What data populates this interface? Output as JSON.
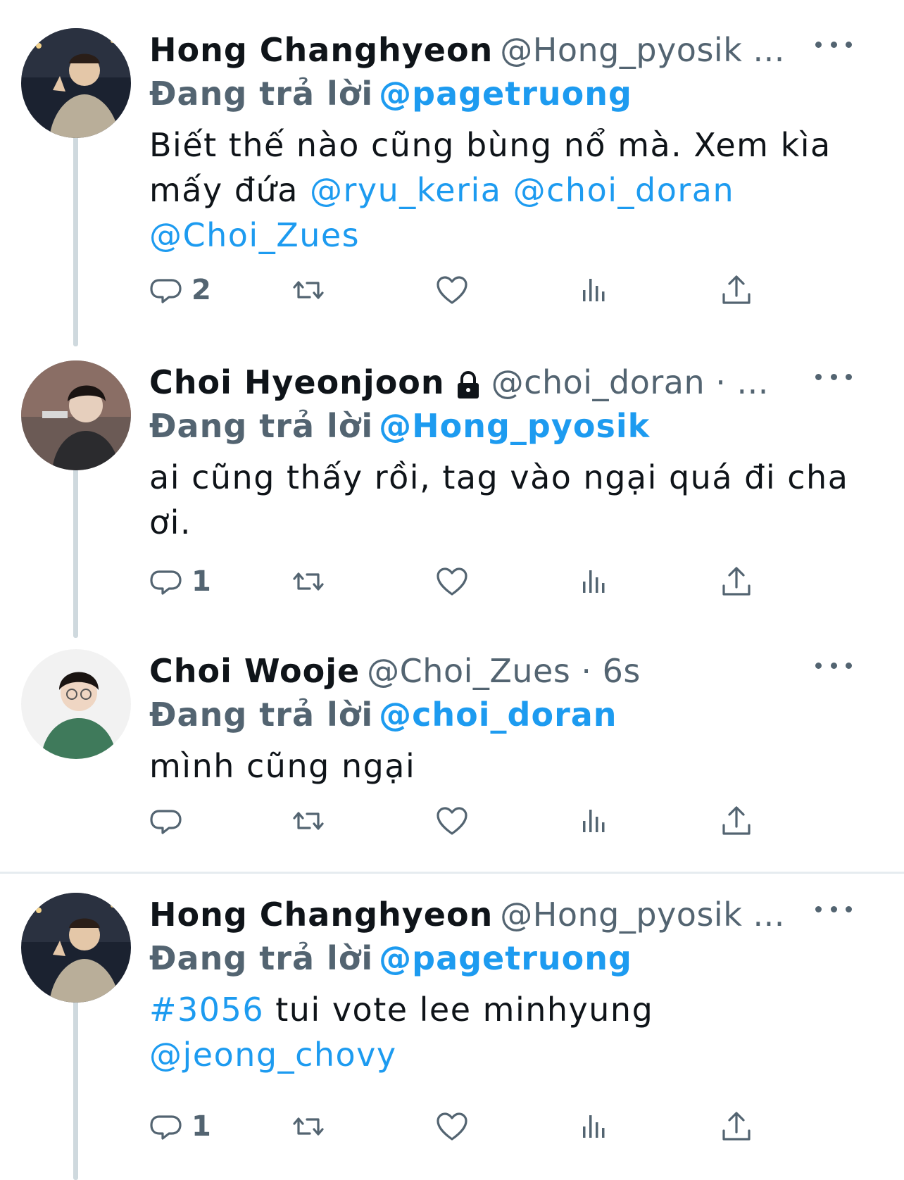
{
  "tweets": [
    {
      "name": "Hong Changhyeon",
      "handle": "@Hong_pyosik ...",
      "replying_label": "Đang trả lời",
      "replying_to": "@pagetruong",
      "text_parts": [
        "Biết thế nào cũng bùng nổ mà. Xem kìa",
        "mấy đứa ",
        "@ryu_keria",
        " ",
        "@choi_doran",
        "@Choi_Zues"
      ],
      "reply_count": "2",
      "avatar": "avatar-hong"
    },
    {
      "name": "Choi Hyeonjoon",
      "handle": "@choi_doran · ...",
      "replying_label": "Đang trả lời",
      "replying_to": "@Hong_pyosik",
      "text_parts": [
        "ai cũng thấy rồi, tag vào ngại quá đi cha",
        "ơi."
      ],
      "reply_count": "1",
      "avatar": "avatar-doran"
    },
    {
      "name": "Choi Wooje",
      "handle": "@Choi_Zues · 6s",
      "replying_label": "Đang trả lời",
      "replying_to": "@choi_doran",
      "text_parts": [
        "mình cũng ngại"
      ],
      "reply_count": "",
      "avatar": "avatar-zeus"
    },
    {
      "name": "Hong Changhyeon",
      "handle": "@Hong_pyosik ...",
      "replying_label": "Đang trả lời",
      "replying_to": "@pagetruong",
      "text_parts": [
        "#3056",
        " tui vote lee minhyung",
        "@jeong_chovy"
      ],
      "reply_count": "1",
      "avatar": "avatar-hong"
    }
  ],
  "icons": [
    "reply-icon",
    "retweet-icon",
    "like-icon",
    "analytics-icon",
    "share-icon",
    "more-icon",
    "lock-icon"
  ],
  "colors": {
    "link": "#1d9bf0",
    "secondary": "#536471",
    "thread_line": "#cfd9de"
  }
}
